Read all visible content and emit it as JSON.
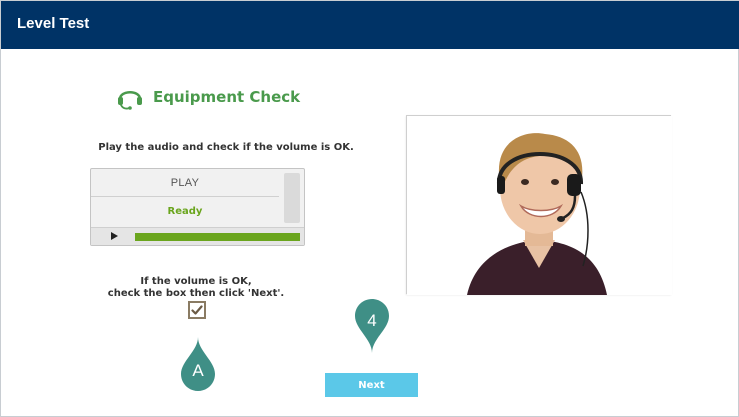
{
  "header": {
    "title": "Level Test"
  },
  "equipment_check": {
    "title": "Equipment Check",
    "icon": "headset-icon",
    "accent_color": "#4a9a4c"
  },
  "instruction": "Play the audio and check if the volume is OK.",
  "player": {
    "play_label": "PLAY",
    "status": "Ready",
    "status_color": "#6aa51d",
    "progress_percent": 100
  },
  "volume_note": {
    "line1": "If the volume is OK,",
    "line2": "check the box then click 'Next'."
  },
  "checkbox": {
    "checked": true
  },
  "markers": {
    "a": "A",
    "b": "4",
    "color": "#3f8f86"
  },
  "next_button": {
    "label": "Next",
    "color": "#5bc8e8"
  },
  "colors": {
    "header_bg": "#003366"
  }
}
